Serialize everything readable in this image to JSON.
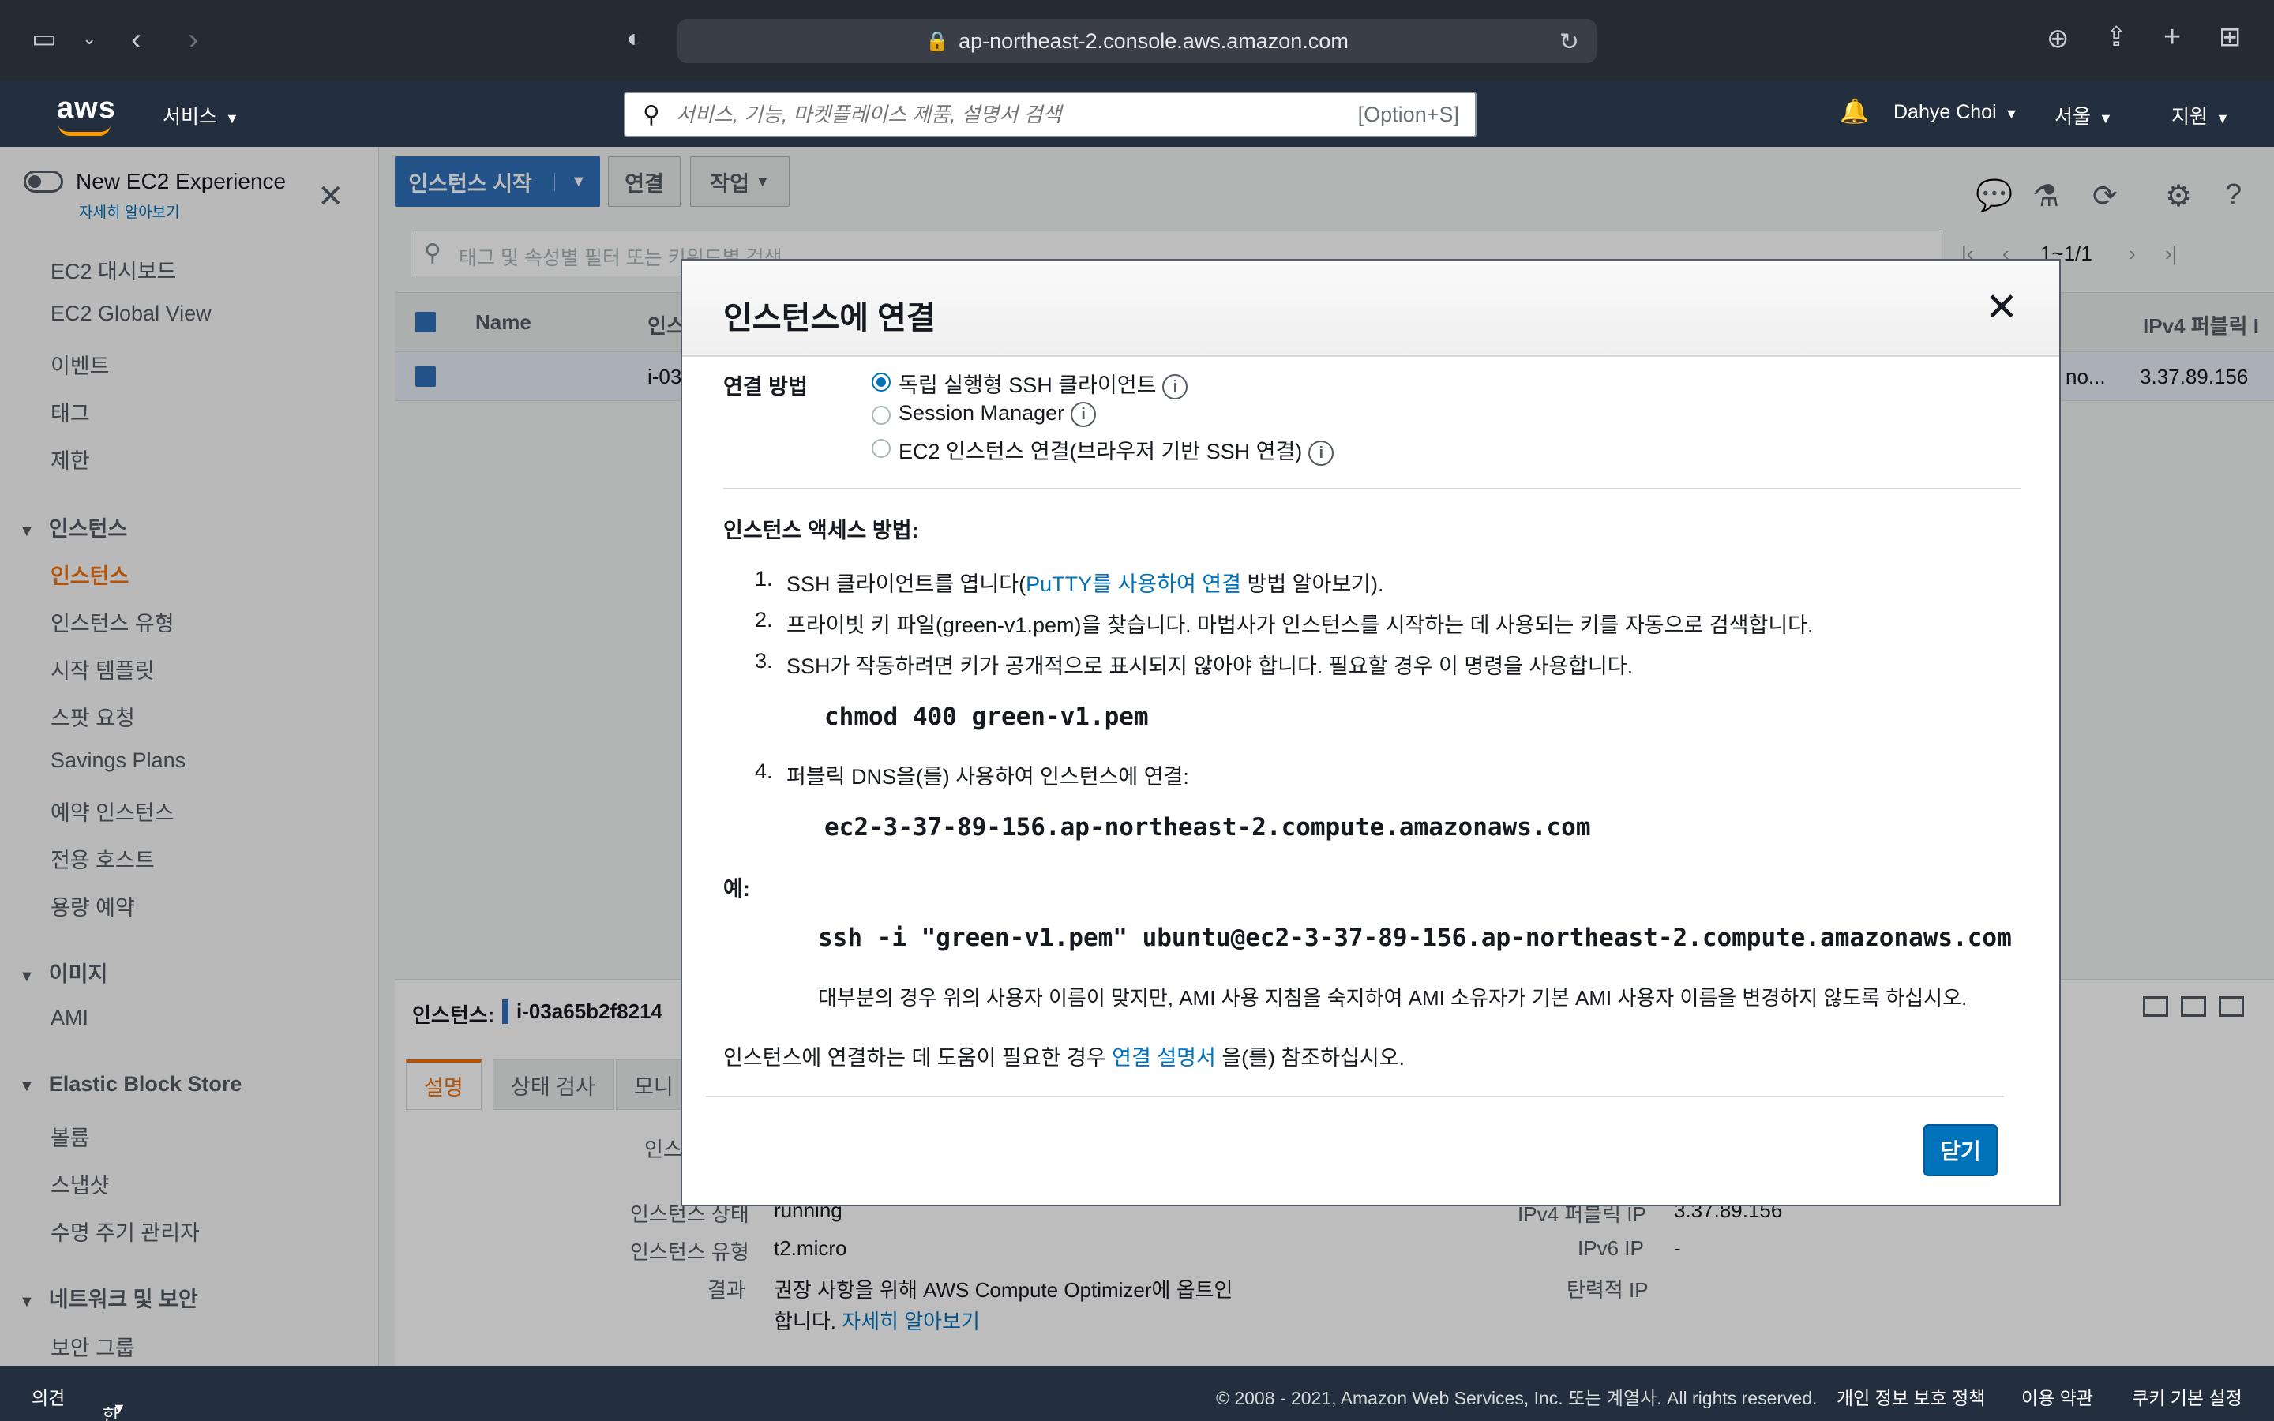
{
  "browser": {
    "url": "ap-northeast-2.console.aws.amazon.com"
  },
  "header": {
    "logo": "aws",
    "services": "서비스",
    "search_placeholder": "서비스, 기능, 마켓플레이스 제품, 설명서 검색",
    "search_shortcut": "[Option+S]",
    "user": "Dahye Choi",
    "region": "서울",
    "support": "지원"
  },
  "sidebar": {
    "new_experience": "New EC2 Experience",
    "learn_more": "자세히 알아보기",
    "items": [
      {
        "label": "EC2 대시보드"
      },
      {
        "label": "EC2 Global View"
      },
      {
        "label": "이벤트"
      },
      {
        "label": "태그"
      },
      {
        "label": "제한"
      }
    ],
    "section_instances": "인스턴스",
    "instances_items": [
      {
        "label": "인스턴스"
      },
      {
        "label": "인스턴스 유형"
      },
      {
        "label": "시작 템플릿"
      },
      {
        "label": "스팟 요청"
      },
      {
        "label": "Savings Plans"
      },
      {
        "label": "예약 인스턴스"
      },
      {
        "label": "전용 호스트"
      },
      {
        "label": "용량 예약"
      }
    ],
    "section_images": "이미지",
    "images_items": [
      {
        "label": "AMI"
      }
    ],
    "section_ebs": "Elastic Block Store",
    "ebs_items": [
      {
        "label": "볼륨"
      },
      {
        "label": "스냅샷"
      },
      {
        "label": "수명 주기 관리자"
      }
    ],
    "section_network": "네트워크 및 보안",
    "network_items": [
      {
        "label": "보안 그룹"
      }
    ]
  },
  "toolbar": {
    "launch": "인스턴스 시작",
    "connect": "연결",
    "actions": "작업"
  },
  "filter": {
    "placeholder": "태그 및 속성별 필터 또는 키워드별 검색",
    "pagination": "1~1/1"
  },
  "table": {
    "col_name": "Name",
    "col_instance": "인스",
    "col_ipv4": "IPv4 퍼블릭 I",
    "row_id": "i-03",
    "row_dns": "no...",
    "row_ip": "3.37.89.156"
  },
  "details": {
    "label": "인스턴스:",
    "instance_id": "i-03a65b2f8214",
    "tabs": [
      {
        "label": "설명"
      },
      {
        "label": "상태 검사"
      },
      {
        "label": "모니"
      }
    ],
    "row0_label": "인스",
    "state_label": "인스턴스 상태",
    "state_value": "running",
    "type_label": "인스턴스 유형",
    "type_value": "t2.micro",
    "result_label": "결과",
    "result_value_1": "권장 사항을 위해 AWS Compute Optimizer에 옵트인",
    "result_value_2": "합니다. ",
    "result_link": "자세히 알아보기",
    "ipv4_label": "IPv4 퍼블릭 IP",
    "ipv4_value": "3.37.89.156",
    "ipv6_label": "IPv6 IP",
    "ipv6_value": "-",
    "eip_label": "탄력적 IP"
  },
  "modal": {
    "title": "인스턴스에 연결",
    "method_label": "연결 방법",
    "options": [
      {
        "label": "독립 실행형 SSH 클라이언트",
        "checked": true
      },
      {
        "label": "Session Manager",
        "checked": false
      },
      {
        "label": "EC2 인스턴스 연결(브라우저 기반 SSH 연결)",
        "checked": false
      }
    ],
    "access_heading": "인스턴스 액세스 방법:",
    "step1_num": "1.",
    "step1_pre": "SSH 클라이언트를 엽니다(",
    "step1_link": "PuTTY를 사용하여 연결",
    "step1_post": " 방법 알아보기).",
    "step2_num": "2.",
    "step2": "프라이빗 키 파일(green-v1.pem)을 찾습니다. 마법사가 인스턴스를 시작하는 데 사용되는 키를 자동으로 검색합니다.",
    "step3_num": "3.",
    "step3": "SSH가 작동하려면 키가 공개적으로 표시되지 않아야 합니다. 필요할 경우 이 명령을 사용합니다.",
    "chmod_cmd": "chmod 400 green-v1.pem",
    "step4_num": "4.",
    "step4": "퍼블릭 DNS을(를) 사용하여 인스턴스에 연결:",
    "dns": "ec2-3-37-89-156.ap-northeast-2.compute.amazonaws.com",
    "example_label": "예:",
    "ssh_cmd": "ssh -i \"green-v1.pem\" ubuntu@ec2-3-37-89-156.ap-northeast-2.compute.amazonaws.com",
    "note": "대부분의 경우 위의 사용자 이름이 맞지만, AMI 사용 지침을 숙지하여 AMI 소유자가 기본 AMI 사용자 이름을 변경하지 않도록 하십시오.",
    "help_pre": "인스턴스에 연결하는 데 도움이 필요한 경우 ",
    "help_link": "연결 설명서",
    "help_post": " 을(를) 참조하십시오.",
    "close_button": "닫기"
  },
  "footer": {
    "feedback": "의견",
    "language": "한국어",
    "copyright": "© 2008 - 2021, Amazon Web Services, Inc. 또는 계열사. All rights reserved.",
    "privacy": "개인 정보 보호 정책",
    "terms": "이용 약관",
    "cookies": "쿠키 기본 설정"
  }
}
